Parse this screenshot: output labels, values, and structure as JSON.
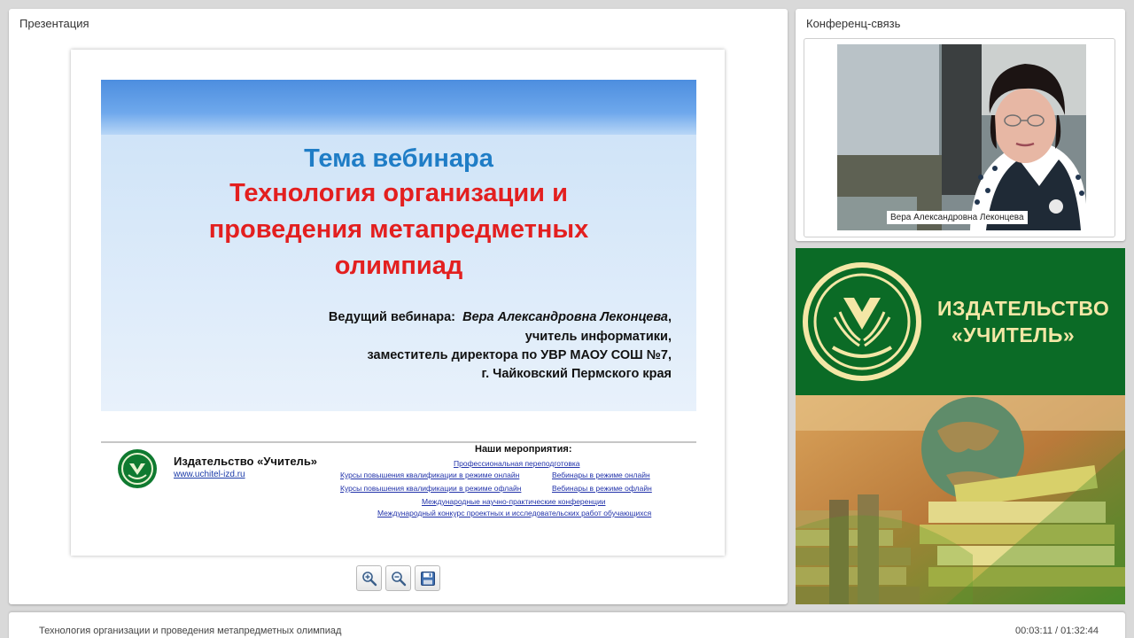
{
  "presentation": {
    "panel_title": "Презентация",
    "slide": {
      "topic_label": "Тема вебинара",
      "title_lines": [
        "Технология организации и",
        "проведения метапредметных",
        "олимпиад"
      ],
      "host_label": "Ведущий вебинара:",
      "host_name": "Вера Александровна Леконцева",
      "host_lines": [
        "учитель информатики,",
        "заместитель директора по УВР МАОУ СОШ №7,",
        "г. Чайковский Пермского края"
      ],
      "footer": {
        "publisher": "Издательство «Учитель»",
        "url": "www.uchitel-izd.ru",
        "events_heading": "Наши мероприятия:",
        "events": [
          "Профессиональная переподготовка",
          "Курсы повышения квалификации в режиме онлайн",
          "Вебинары в режиме онлайн",
          "Курсы повышения квалификации в режиме офлайн",
          "Вебинары в режиме офлайн",
          "Международные научно-практические конференции",
          "Международный конкурс проектных и исследовательских работ обучающихся"
        ]
      }
    },
    "toolbar": {
      "zoom_in_icon": "zoom-in-icon",
      "zoom_out_icon": "zoom-out-icon",
      "save_icon": "floppy-disk-icon"
    }
  },
  "conference": {
    "panel_title": "Конференц-связь",
    "participant_name": "Вера Александровна Леконцева"
  },
  "ad_banner": {
    "line_1": "ИЗДАТЕЛЬСТВО",
    "line_2": "«УЧИТЕЛЬ»",
    "colors": {
      "green": "#0b6b26",
      "gold": "#f4e7a6"
    }
  },
  "status_bar": {
    "lecture_title": "Технология организации и проведения метапредметных олимпиад",
    "playback_time": "00:03:11 / 01:32:44"
  },
  "colors": {
    "slide_title_red": "#e31f1f",
    "slide_topic_blue": "#1f7dc6",
    "link_blue": "#2233aa"
  }
}
